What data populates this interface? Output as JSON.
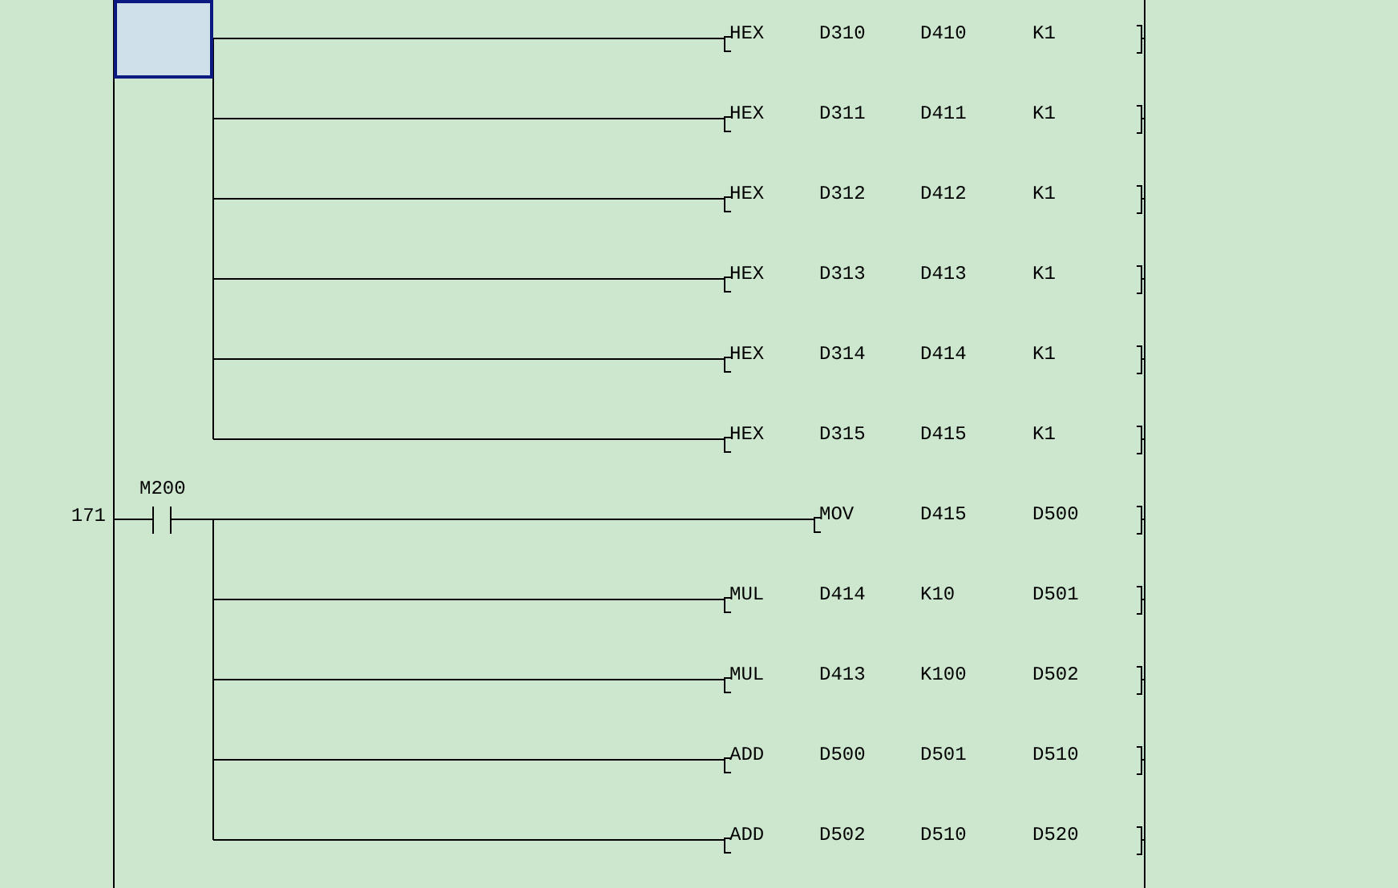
{
  "blocks": [
    {
      "selected": true,
      "outputs": [
        {
          "instruction": "HEX",
          "operands": [
            "D310",
            "D410",
            "K1"
          ]
        },
        {
          "instruction": "HEX",
          "operands": [
            "D311",
            "D411",
            "K1"
          ]
        },
        {
          "instruction": "HEX",
          "operands": [
            "D312",
            "D412",
            "K1"
          ]
        },
        {
          "instruction": "HEX",
          "operands": [
            "D313",
            "D413",
            "K1"
          ]
        },
        {
          "instruction": "HEX",
          "operands": [
            "D314",
            "D414",
            "K1"
          ]
        },
        {
          "instruction": "HEX",
          "operands": [
            "D315",
            "D415",
            "K1"
          ]
        }
      ]
    },
    {
      "selected": false,
      "step": "171",
      "contact": {
        "kind": "normally_open",
        "label": "M200"
      },
      "outputs": [
        {
          "instruction": "MOV",
          "operands": [
            "D415",
            "D500"
          ]
        },
        {
          "instruction": "MUL",
          "operands": [
            "D414",
            "K10",
            "D501"
          ]
        },
        {
          "instruction": "MUL",
          "operands": [
            "D413",
            "K100",
            "D502"
          ]
        },
        {
          "instruction": "ADD",
          "operands": [
            "D500",
            "D501",
            "D510"
          ]
        },
        {
          "instruction": "ADD",
          "operands": [
            "D502",
            "D510",
            "D520"
          ]
        }
      ]
    }
  ]
}
